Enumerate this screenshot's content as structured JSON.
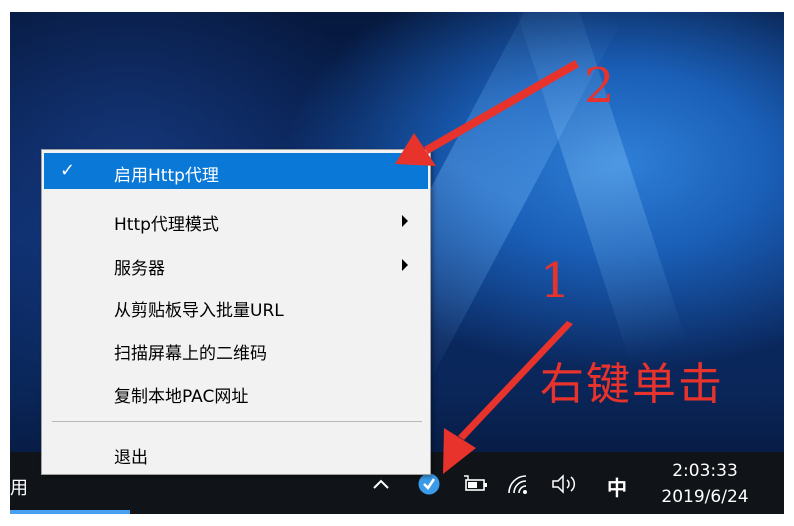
{
  "taskbar": {
    "left_label": "用",
    "clock_time": "2:03:33",
    "clock_date": "2019/6/24",
    "ime_label": "中"
  },
  "tray_icons": [
    "chevron-up-icon",
    "shadowsocks-icon",
    "battery-icon",
    "wifi-icon",
    "volume-icon"
  ],
  "context_menu": {
    "items": [
      {
        "label": "启用Http代理",
        "checked": true,
        "submenu": false,
        "highlighted": true
      },
      {
        "label": "Http代理模式",
        "checked": false,
        "submenu": true
      },
      {
        "label": "服务器",
        "checked": false,
        "submenu": true
      },
      {
        "label": "从剪贴板导入批量URL",
        "checked": false,
        "submenu": false
      },
      {
        "label": "扫描屏幕上的二维码",
        "checked": false,
        "submenu": false
      },
      {
        "label": "复制本地PAC网址",
        "checked": false,
        "submenu": false
      },
      {
        "label": "退出",
        "checked": false,
        "submenu": false
      }
    ],
    "check_glyph": "✓"
  },
  "annotations": {
    "step1_number": "1",
    "step2_number": "2",
    "step1_text": "右键单击",
    "color": "#e8322c"
  },
  "colors": {
    "highlight": "#0a78d7",
    "taskbar": "#101418",
    "tray_app_icon": "#3a9be8"
  }
}
